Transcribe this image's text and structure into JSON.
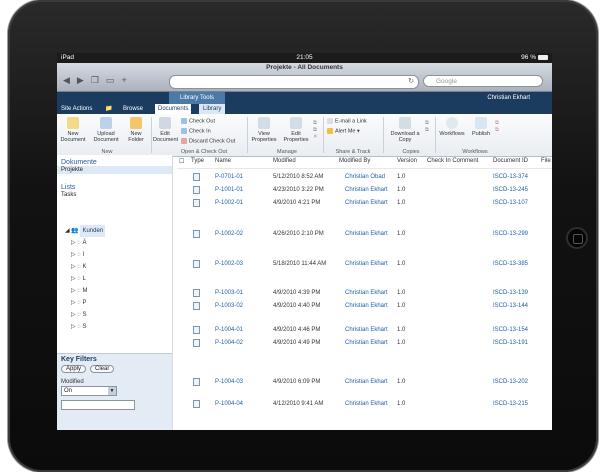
{
  "status": {
    "carrier": "iPad",
    "time": "21:05",
    "battery": "96 %"
  },
  "browser": {
    "title": "Projekte - All Documents",
    "search_placeholder": "Google"
  },
  "sharepoint": {
    "site_actions": "Site Actions",
    "browse": "Browse",
    "library_tools": "Library Tools",
    "tab_documents": "Documents",
    "tab_library": "Library",
    "user": "Christian Ekhart"
  },
  "ribbon": {
    "new_document": "New Document",
    "upload_document": "Upload Document",
    "new_folder": "New Folder",
    "group_new": "New",
    "edit_document": "Edit Document",
    "check_out": "Check Out",
    "check_in": "Check In",
    "discard_check_out": "Discard Check Out",
    "group_open": "Open & Check Out",
    "view_properties": "View Properties",
    "edit_properties": "Edit Properties",
    "group_manage": "Manage",
    "email_link": "E-mail a Link",
    "alert_me": "Alert Me",
    "group_share": "Share & Track",
    "download_copy": "Download a Copy",
    "group_copies": "Copies",
    "workflows": "Workflows",
    "publish": "Publish",
    "group_workflows": "Workflows"
  },
  "nav": {
    "documents_heading": "Dokumente",
    "projekte": "Projekte",
    "lists_heading": "Lists",
    "tasks": "Tasks",
    "tree_root": "Kunden",
    "tree": [
      "Ä",
      "I",
      "K",
      "L",
      "M",
      "P",
      "S",
      "S"
    ]
  },
  "keyfilters": {
    "title": "Key Filters",
    "apply": "Apply",
    "clear": "Clear",
    "modified_label": "Modified",
    "operator": "On"
  },
  "columns": [
    "Type",
    "Name",
    "Modified",
    "Modified By",
    "Version",
    "Check In Comment",
    "Document ID",
    "File"
  ],
  "rows": [
    {
      "name": "P-0701-01",
      "modified": "5/12/2010 8:52 AM",
      "by": "Christian Obad",
      "version": "1.0",
      "docid": "ISCD-13-374"
    },
    {
      "name": "P-1001-01",
      "modified": "4/23/2010 3:22 PM",
      "by": "Christian Ekhart",
      "version": "1.0",
      "docid": "ISCD-13-245"
    },
    {
      "name": "P-1002-01",
      "modified": "4/9/2010 4:21 PM",
      "by": "Christian Ekhart",
      "version": "1.0",
      "docid": "ISCD-13-107"
    },
    {
      "name": "P-1002-02",
      "modified": "4/26/2010 2:10 PM",
      "by": "Christian Ekhart",
      "version": "1.0",
      "docid": "ISCD-13-299"
    },
    {
      "name": "P-1002-03",
      "modified": "5/18/2010 11:44 AM",
      "by": "Christian Ekhart",
      "version": "1.0",
      "docid": "ISCD-13-385"
    },
    {
      "name": "P-1003-01",
      "modified": "4/9/2010 4:39 PM",
      "by": "Christian Ekhart",
      "version": "1.0",
      "docid": "ISCD-13-139"
    },
    {
      "name": "P-1003-02",
      "modified": "4/9/2010 4:40 PM",
      "by": "Christian Ekhart",
      "version": "1.0",
      "docid": "ISCD-13-144"
    },
    {
      "name": "P-1004-01",
      "modified": "4/9/2010 4:46 PM",
      "by": "Christian Ekhart",
      "version": "1.0",
      "docid": "ISCD-13-154"
    },
    {
      "name": "P-1004-02",
      "modified": "4/9/2010 4:49 PM",
      "by": "Christian Ekhart",
      "version": "1.0",
      "docid": "ISCD-13-191"
    },
    {
      "name": "P-1004-03",
      "modified": "4/9/2010 6:09 PM",
      "by": "Christian Ekhart",
      "version": "1.0",
      "docid": "ISCD-13-202"
    },
    {
      "name": "P-1004-04",
      "modified": "4/12/2010 9:41 AM",
      "by": "Christian Ekhart",
      "version": "1.0",
      "docid": "ISCD-13-215"
    }
  ]
}
